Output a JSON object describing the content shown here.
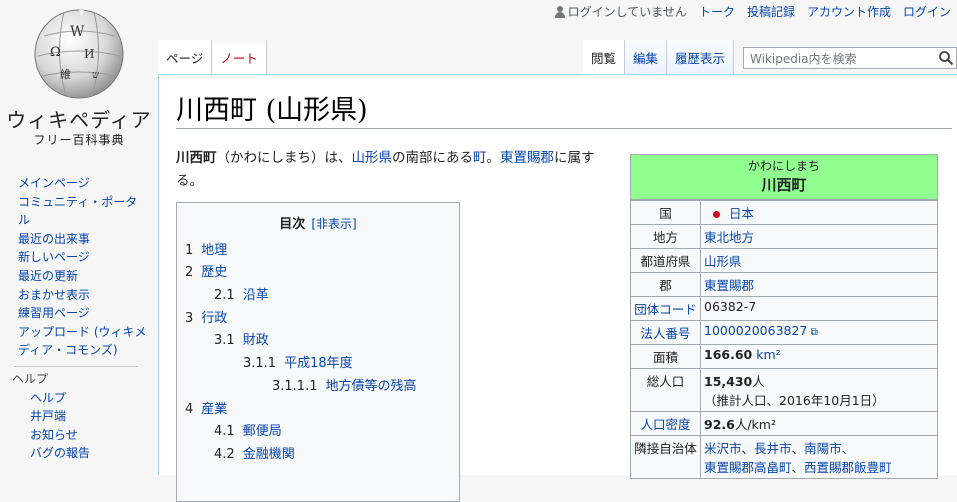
{
  "personal": {
    "status": "ログインしていません",
    "links": [
      "トーク",
      "投稿記録",
      "アカウント作成",
      "ログイン"
    ]
  },
  "logo": {
    "wordmark": "ウィキペディア",
    "tagline": "フリー百科事典"
  },
  "sidebar": {
    "nav": [
      "メインページ",
      "コミュニティ・ポータル",
      "最近の出来事",
      "新しいページ",
      "最近の更新",
      "おまかせ表示",
      "練習用ページ",
      "アップロード (ウィキメディア・コモンズ)"
    ],
    "help_heading": "ヘルプ",
    "help": [
      "ヘルプ",
      "井戸端",
      "お知らせ",
      "バグの報告"
    ]
  },
  "tabs": {
    "page": "ページ",
    "talk": "ノート",
    "read": "閲覧",
    "edit": "編集",
    "history": "履歴表示"
  },
  "search": {
    "placeholder": "Wikipedia内を検索"
  },
  "article": {
    "title": "川西町 (山形県)",
    "lead": {
      "name": "川西町",
      "t1": "（かわにしまち）は、",
      "pref": "山形県",
      "t2": "の南部にある",
      "town": "町",
      "t3": "。",
      "district": "東置賜郡",
      "t4": "に属する。"
    }
  },
  "toc": {
    "title": "目次",
    "toggle": "[非表示]",
    "items": [
      {
        "num": "1",
        "label": "地理"
      },
      {
        "num": "2",
        "label": "歴史"
      },
      {
        "num": "2.1",
        "label": "沿革"
      },
      {
        "num": "3",
        "label": "行政"
      },
      {
        "num": "3.1",
        "label": "財政"
      },
      {
        "num": "3.1.1",
        "label": "平成18年度"
      },
      {
        "num": "3.1.1.1",
        "label": "地方債等の残高"
      },
      {
        "num": "4",
        "label": "産業"
      },
      {
        "num": "4.1",
        "label": "郵便局"
      },
      {
        "num": "4.2",
        "label": "金融機関"
      }
    ]
  },
  "infobox": {
    "kana": "かわにしまち",
    "name": "川西町",
    "header_color": "#90ff90",
    "rows": {
      "country_k": "国",
      "country_v": "日本",
      "region_k": "地方",
      "region_v": "東北地方",
      "pref_k": "都道府県",
      "pref_v": "山形県",
      "district_k": "郡",
      "district_v": "東置賜郡",
      "code_k": "団体コード",
      "code_v": "06382-7",
      "corp_k": "法人番号",
      "corp_v": "1000020063827",
      "area_k": "面積",
      "area_v": "166.60",
      "area_unit": "km²",
      "pop_k": "総人口",
      "pop_v": "15,430",
      "pop_unit": "人",
      "pop_note": "（推計人口、2016年10月1日）",
      "density_k": "人口密度",
      "density_v": "92.6",
      "density_unit": "人/km²",
      "adj_k": "隣接自治体",
      "adj_1": "米沢市",
      "adj_2": "長井市",
      "adj_3": "南陽市",
      "adj_4": "東置賜郡高畠町",
      "adj_5": "西置賜郡飯豊町"
    }
  }
}
